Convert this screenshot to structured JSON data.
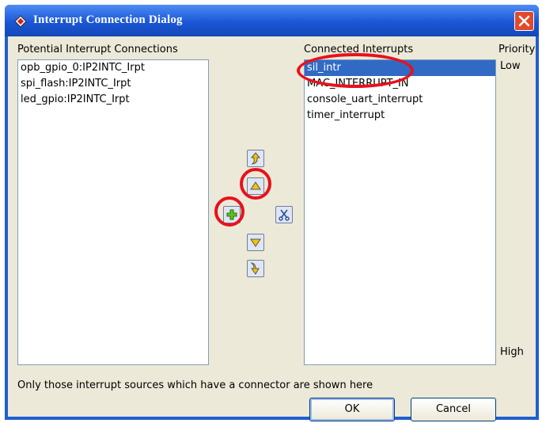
{
  "window": {
    "title": "Interrupt Connection Dialog"
  },
  "potential": {
    "label": "Potential Interrupt Connections",
    "items": [
      "opb_gpio_0:IP2INTC_Irpt",
      "spi_flash:IP2INTC_Irpt",
      "led_gpio:IP2INTC_Irpt"
    ]
  },
  "connected": {
    "label": "Connected Interrupts",
    "items": [
      "sil_intr",
      "MAC_INTERRUPT_IN",
      "console_uart_interrupt",
      "timer_interrupt"
    ],
    "selected": "sil_intr"
  },
  "priority": {
    "label": "Priority",
    "low": "Low",
    "high": "High"
  },
  "toolbar": {
    "move_top_icon": "move-to-top-icon",
    "move_up_icon": "move-up-icon",
    "add_icon": "add-icon",
    "remove_icon": "scissors-icon",
    "move_down_icon": "move-down-icon",
    "move_bottom_icon": "move-to-bottom-icon"
  },
  "footer": {
    "note": "Only those interrupt sources which have a connector are shown here",
    "ok_label": "OK",
    "cancel_label": "Cancel"
  },
  "colors": {
    "highlight_ring": "#e8111b",
    "selection": "#316ac5",
    "titlebar": "#1a56d6"
  }
}
